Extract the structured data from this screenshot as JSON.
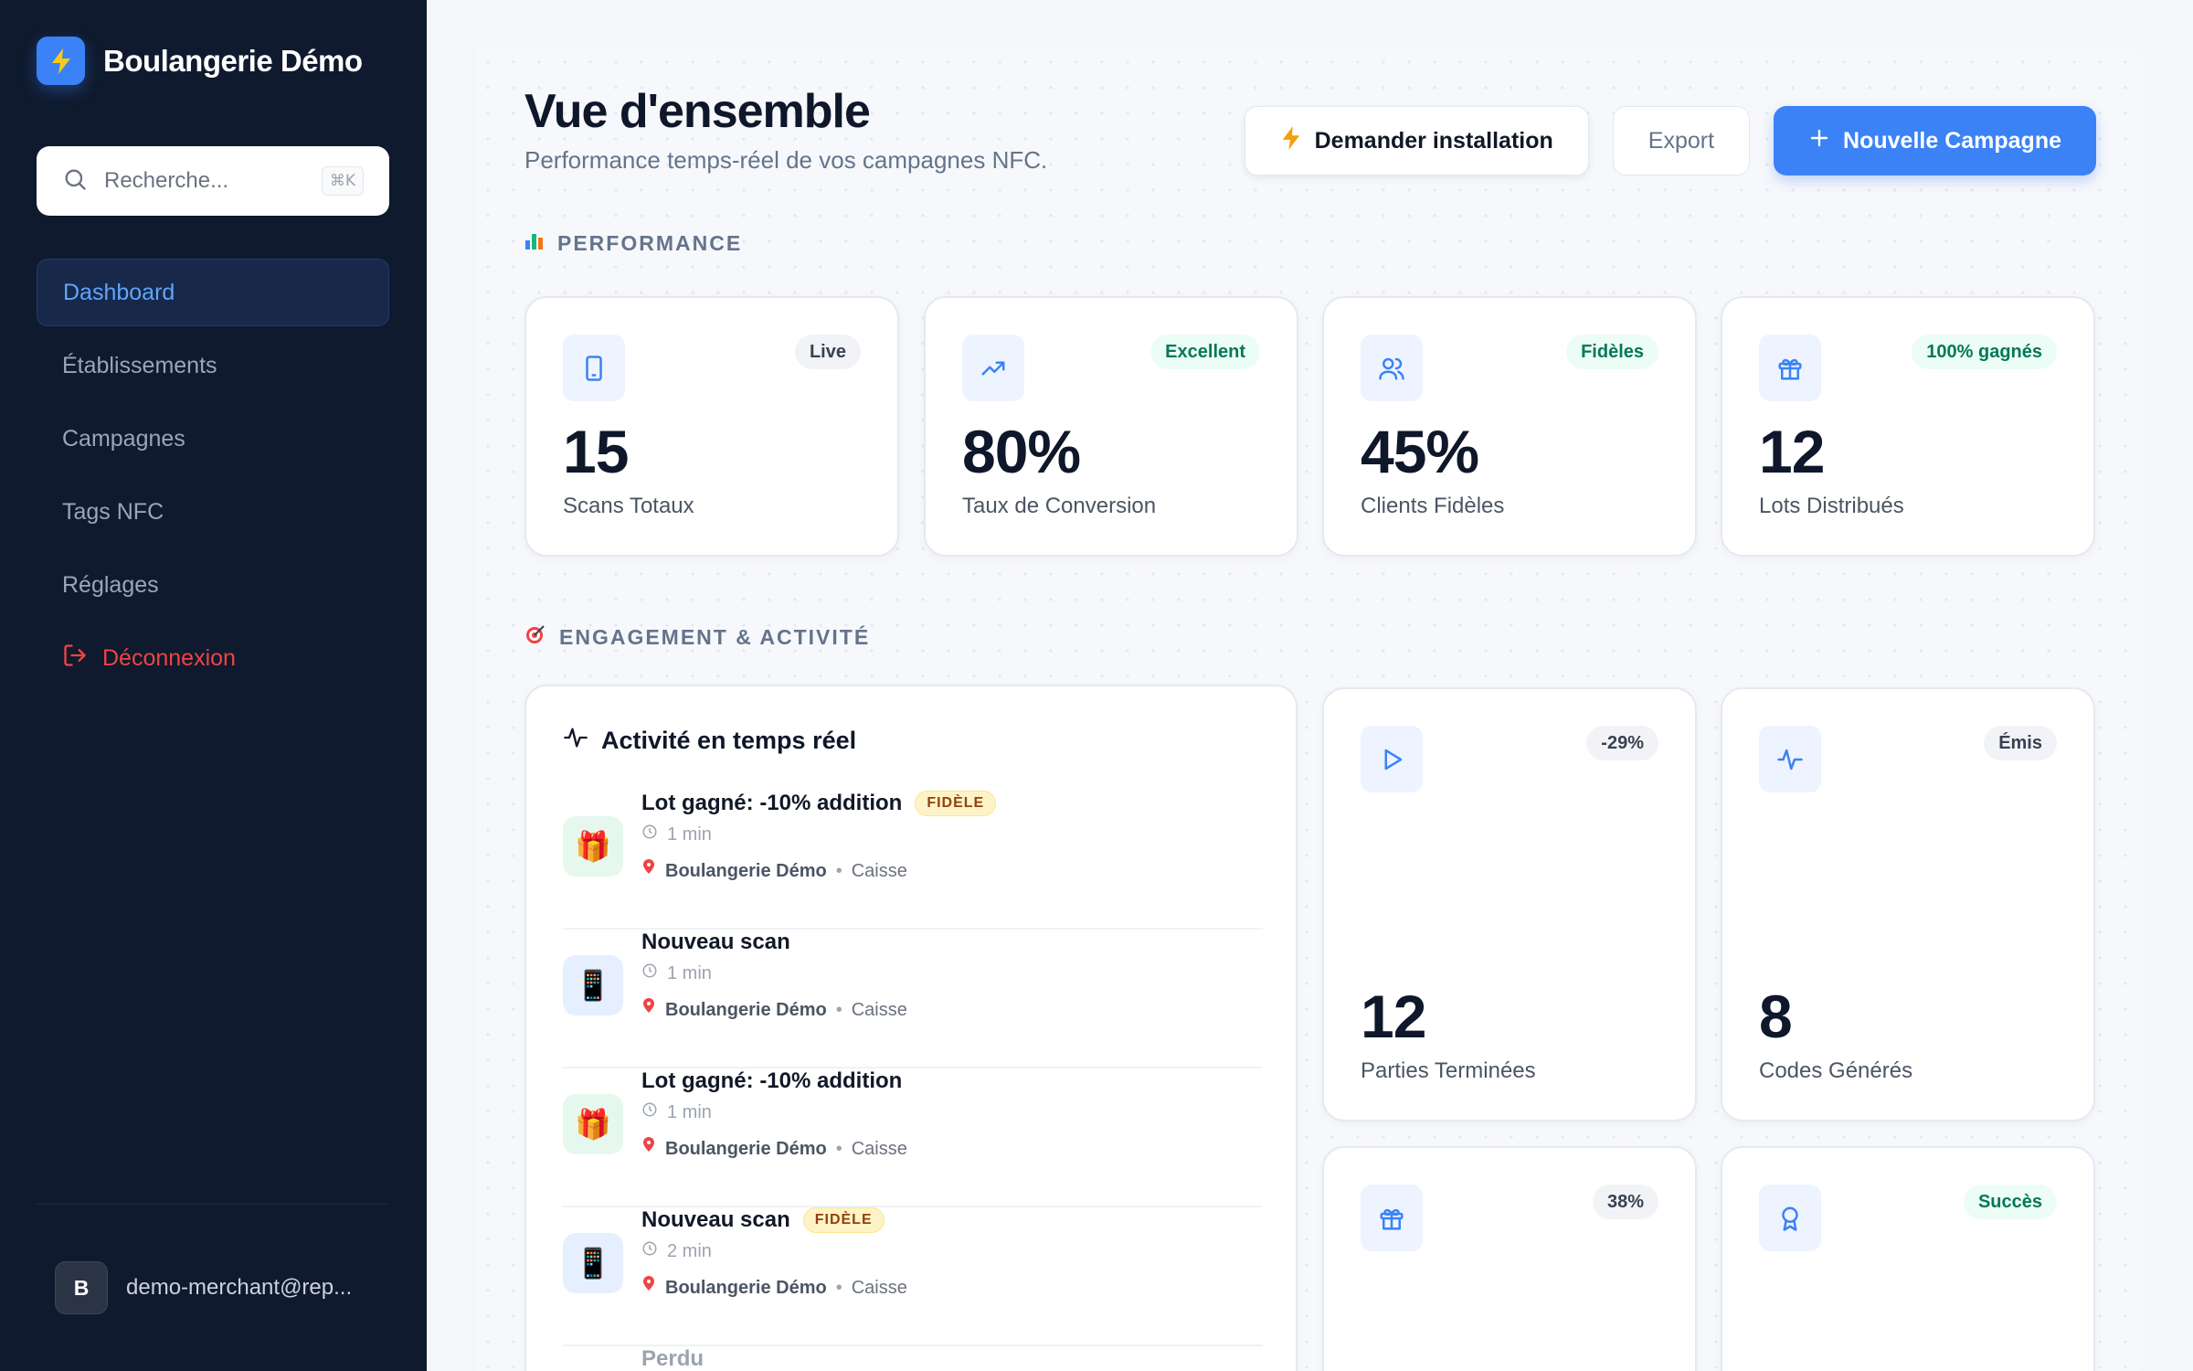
{
  "brand": {
    "name": "Boulangerie Démo",
    "logo_icon": "bolt-icon"
  },
  "search": {
    "placeholder": "Recherche...",
    "shortcut": "⌘K"
  },
  "nav": {
    "items": [
      {
        "label": "Dashboard",
        "active": true
      },
      {
        "label": "Établissements"
      },
      {
        "label": "Campagnes"
      },
      {
        "label": "Tags NFC"
      },
      {
        "label": "Réglages"
      }
    ],
    "logout_label": "Déconnexion"
  },
  "user": {
    "initial": "B",
    "email": "demo-merchant@rep..."
  },
  "header": {
    "title": "Vue d'ensemble",
    "subtitle": "Performance temps-réel de vos campagnes NFC.",
    "install_label": "Demander installation",
    "export_label": "Export",
    "new_label": "Nouvelle Campagne"
  },
  "sections": {
    "performance": "PERFORMANCE",
    "engagement": "ENGAGEMENT & ACTIVITÉ"
  },
  "stats": [
    {
      "value": "15",
      "label": "Scans Totaux",
      "badge": "Live",
      "icon": "phone-icon"
    },
    {
      "value": "80%",
      "label": "Taux de Conversion",
      "badge": "Excellent",
      "icon": "trending-up-icon"
    },
    {
      "value": "45%",
      "label": "Clients Fidèles",
      "badge": "Fidèles",
      "icon": "users-icon"
    },
    {
      "value": "12",
      "label": "Lots Distribués",
      "badge": "100% gagnés",
      "icon": "gift-icon"
    }
  ],
  "engagement_stats": [
    {
      "value": "12",
      "label": "Parties Terminées",
      "badge": "-29%",
      "icon": "play-icon"
    },
    {
      "value": "8",
      "label": "Codes Générés",
      "badge": "Émis",
      "icon": "activity-icon"
    },
    {
      "badge": "38%",
      "icon": "gift-icon"
    },
    {
      "badge": "Succès",
      "icon": "award-icon"
    }
  ],
  "activity": {
    "title": "Activité en temps réel",
    "items": [
      {
        "title": "Lot gagné: -10% addition",
        "tag": "FIDÈLE",
        "time": "1 min",
        "place": "Boulangerie Démo",
        "where": "Caisse",
        "icon": "🎁"
      },
      {
        "title": "Nouveau scan",
        "tag": "",
        "time": "1 min",
        "place": "Boulangerie Démo",
        "where": "Caisse",
        "icon": "📱"
      },
      {
        "title": "Lot gagné: -10% addition",
        "tag": "",
        "time": "1 min",
        "place": "Boulangerie Démo",
        "where": "Caisse",
        "icon": "🎁"
      },
      {
        "title": "Nouveau scan",
        "tag": "FIDÈLE",
        "time": "2 min",
        "place": "Boulangerie Démo",
        "where": "Caisse",
        "icon": "📱"
      }
    ],
    "partial_title": "Perdu"
  },
  "colors": {
    "accent": "#3b82f6",
    "sidebar": "#0f1a2e",
    "danger": "#ef4444",
    "success": "#047857"
  }
}
